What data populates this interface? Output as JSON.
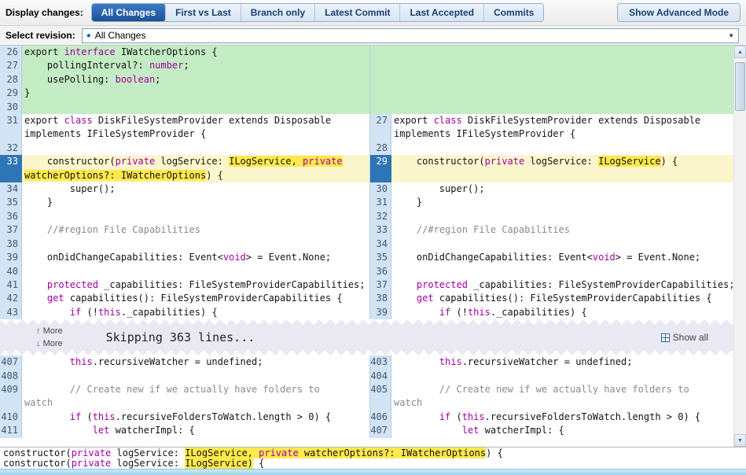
{
  "toolbar": {
    "display_changes_label": "Display changes:",
    "tabs": [
      {
        "label": "All Changes",
        "selected": true
      },
      {
        "label": "First vs Last",
        "selected": false
      },
      {
        "label": "Branch only",
        "selected": false
      },
      {
        "label": "Latest Commit",
        "selected": false
      },
      {
        "label": "Last Accepted",
        "selected": false
      },
      {
        "label": "Commits",
        "selected": false
      }
    ],
    "advanced_button": "Show Advanced Mode"
  },
  "revision": {
    "label": "Select revision:",
    "selected": "All Changes"
  },
  "icons": {
    "revision_dot": "●",
    "dropdown_caret": "▼",
    "more_up": "↑",
    "more_down": "↓",
    "scroll_up": "▲",
    "scroll_down": "▼"
  },
  "skip_band": {
    "more_up_label": "More",
    "more_down_label": "More",
    "skipping_text": "Skipping 363 lines...",
    "show_all_label": "Show all"
  },
  "colors": {
    "added_bg": "#c4ecc4",
    "changed_bg": "#fbf6cc",
    "intraline_highlight": "#ffe94d",
    "changed_line_marker": "#2e75b6",
    "selected_tab": "#1d5194"
  },
  "diff": {
    "sections": [
      {
        "rows": [
          {
            "l": {
              "num": "26",
              "bg": "add",
              "seg": [
                [
                  "export ",
                  ""
                ],
                [
                  "interface",
                  "k"
                ],
                [
                  " IWatcherOptions {",
                  ""
                ]
              ]
            },
            "r": {
              "bg": "add",
              "gut": "add",
              "seg": []
            }
          },
          {
            "l": {
              "num": "27",
              "bg": "add",
              "seg": [
                [
                  "    pollingInterval?: ",
                  ""
                ],
                [
                  "number",
                  "k"
                ],
                [
                  ";",
                  ""
                ]
              ]
            },
            "r": {
              "bg": "add",
              "gut": "add",
              "seg": []
            }
          },
          {
            "l": {
              "num": "28",
              "bg": "add",
              "seg": [
                [
                  "    usePolling: ",
                  ""
                ],
                [
                  "boolean",
                  "k"
                ],
                [
                  ";",
                  ""
                ]
              ]
            },
            "r": {
              "bg": "add",
              "gut": "add",
              "seg": []
            }
          },
          {
            "l": {
              "num": "29",
              "bg": "add",
              "seg": [
                [
                  "}",
                  ""
                ]
              ]
            },
            "r": {
              "bg": "add",
              "gut": "add",
              "seg": []
            }
          },
          {
            "l": {
              "num": "30",
              "bg": "add",
              "seg": []
            },
            "r": {
              "bg": "add",
              "gut": "add",
              "seg": []
            }
          },
          {
            "l": {
              "num": "31",
              "seg": [
                [
                  "export ",
                  ""
                ],
                [
                  "class",
                  "k"
                ],
                [
                  " DiskFileSystemProvider extends Disposable",
                  ""
                ]
              ]
            },
            "r": {
              "num": "27",
              "seg": [
                [
                  "export ",
                  ""
                ],
                [
                  "class",
                  "k"
                ],
                [
                  " DiskFileSystemProvider extends Disposable",
                  ""
                ]
              ]
            }
          },
          {
            "l": {
              "seg": [
                [
                  "implements IFileSystemProvider {",
                  ""
                ]
              ]
            },
            "r": {
              "seg": [
                [
                  "implements IFileSystemProvider {",
                  ""
                ]
              ]
            }
          },
          {
            "l": {
              "num": "32",
              "seg": []
            },
            "r": {
              "num": "28",
              "seg": []
            }
          },
          {
            "l": {
              "num": "33",
              "bg": "chg",
              "mark": true,
              "seg": [
                [
                  "    constructor(",
                  ""
                ],
                [
                  "private",
                  "k"
                ],
                [
                  " logService: ",
                  ""
                ],
                [
                  "ILogService, ",
                  "h"
                ],
                [
                  "private",
                  "k h"
                ]
              ]
            },
            "r": {
              "num": "29",
              "bg": "chg",
              "mark": true,
              "seg": [
                [
                  "    constructor(",
                  ""
                ],
                [
                  "private",
                  "k"
                ],
                [
                  " logService: ",
                  ""
                ],
                [
                  "ILogService",
                  "h"
                ],
                [
                  ") {",
                  ""
                ]
              ]
            }
          },
          {
            "l": {
              "bg": "chg",
              "mark": true,
              "seg": [
                [
                  "watcherOptions?: IWatcherOptions",
                  "h"
                ],
                [
                  ") {",
                  ""
                ]
              ]
            },
            "r": {
              "bg": "chg",
              "mark": true,
              "seg": []
            }
          },
          {
            "l": {
              "num": "34",
              "seg": [
                [
                  "        super();",
                  ""
                ]
              ]
            },
            "r": {
              "num": "30",
              "seg": [
                [
                  "        super();",
                  ""
                ]
              ]
            }
          },
          {
            "l": {
              "num": "35",
              "seg": [
                [
                  "    }",
                  ""
                ]
              ]
            },
            "r": {
              "num": "31",
              "seg": [
                [
                  "    }",
                  ""
                ]
              ]
            }
          },
          {
            "l": {
              "num": "36",
              "seg": []
            },
            "r": {
              "num": "32",
              "seg": []
            }
          },
          {
            "l": {
              "num": "37",
              "seg": [
                [
                  "    //#region File Capabilities",
                  "c"
                ]
              ]
            },
            "r": {
              "num": "33",
              "seg": [
                [
                  "    //#region File Capabilities",
                  "c"
                ]
              ]
            }
          },
          {
            "l": {
              "num": "38",
              "seg": []
            },
            "r": {
              "num": "34",
              "seg": []
            }
          },
          {
            "l": {
              "num": "39",
              "seg": [
                [
                  "    onDidChangeCapabilities: Event<",
                  ""
                ],
                [
                  "void",
                  "k"
                ],
                [
                  "> = Event.None;",
                  ""
                ]
              ]
            },
            "r": {
              "num": "35",
              "seg": [
                [
                  "    onDidChangeCapabilities: Event<",
                  ""
                ],
                [
                  "void",
                  "k"
                ],
                [
                  "> = Event.None;",
                  ""
                ]
              ]
            }
          },
          {
            "l": {
              "num": "40",
              "seg": []
            },
            "r": {
              "num": "36",
              "seg": []
            }
          },
          {
            "l": {
              "num": "41",
              "seg": [
                [
                  "    ",
                  ""
                ],
                [
                  "protected",
                  "k"
                ],
                [
                  " _capabilities: FileSystemProviderCapabilities;",
                  ""
                ]
              ]
            },
            "r": {
              "num": "37",
              "seg": [
                [
                  "    ",
                  ""
                ],
                [
                  "protected",
                  "k"
                ],
                [
                  " _capabilities: FileSystemProviderCapabilities;",
                  ""
                ]
              ]
            }
          },
          {
            "l": {
              "num": "42",
              "seg": [
                [
                  "    ",
                  ""
                ],
                [
                  "get",
                  "k"
                ],
                [
                  " capabilities(): FileSystemProviderCapabilities {",
                  ""
                ]
              ]
            },
            "r": {
              "num": "38",
              "seg": [
                [
                  "    ",
                  ""
                ],
                [
                  "get",
                  "k"
                ],
                [
                  " capabilities(): FileSystemProviderCapabilities {",
                  ""
                ]
              ]
            }
          },
          {
            "l": {
              "num": "43",
              "seg": [
                [
                  "        ",
                  ""
                ],
                [
                  "if",
                  "k"
                ],
                [
                  " (!",
                  ""
                ],
                [
                  "this",
                  "k"
                ],
                [
                  "._capabilities) {",
                  ""
                ]
              ]
            },
            "r": {
              "num": "39",
              "seg": [
                [
                  "        ",
                  ""
                ],
                [
                  "if",
                  "k"
                ],
                [
                  " (!",
                  ""
                ],
                [
                  "this",
                  "k"
                ],
                [
                  "._capabilities) {",
                  ""
                ]
              ]
            }
          }
        ]
      },
      {
        "rows": [
          {
            "l": {
              "num": "407",
              "seg": [
                [
                  "        ",
                  ""
                ],
                [
                  "this",
                  "k"
                ],
                [
                  ".recursiveWatcher = undefined;",
                  ""
                ]
              ]
            },
            "r": {
              "num": "403",
              "seg": [
                [
                  "        ",
                  ""
                ],
                [
                  "this",
                  "k"
                ],
                [
                  ".recursiveWatcher = undefined;",
                  ""
                ]
              ]
            }
          },
          {
            "l": {
              "num": "408",
              "seg": []
            },
            "r": {
              "num": "404",
              "seg": []
            }
          },
          {
            "l": {
              "num": "409",
              "seg": [
                [
                  "        // Create new if we actually have folders to",
                  "c"
                ]
              ]
            },
            "r": {
              "num": "405",
              "seg": [
                [
                  "        // Create new if we actually have folders to",
                  "c"
                ]
              ]
            }
          },
          {
            "l": {
              "seg": [
                [
                  "watch",
                  "c"
                ]
              ]
            },
            "r": {
              "seg": [
                [
                  "watch",
                  "c"
                ]
              ]
            }
          },
          {
            "l": {
              "num": "410",
              "seg": [
                [
                  "        ",
                  ""
                ],
                [
                  "if",
                  "k"
                ],
                [
                  " (",
                  ""
                ],
                [
                  "this",
                  "k"
                ],
                [
                  ".recursiveFoldersToWatch.length > 0) {",
                  ""
                ]
              ]
            },
            "r": {
              "num": "406",
              "seg": [
                [
                  "        ",
                  ""
                ],
                [
                  "if",
                  "k"
                ],
                [
                  " (",
                  ""
                ],
                [
                  "this",
                  "k"
                ],
                [
                  ".recursiveFoldersToWatch.length > 0) {",
                  ""
                ]
              ]
            }
          },
          {
            "l": {
              "num": "411",
              "seg": [
                [
                  "            ",
                  ""
                ],
                [
                  "let",
                  "k"
                ],
                [
                  " watcherImpl: {",
                  ""
                ]
              ]
            },
            "r": {
              "num": "407",
              "seg": [
                [
                  "            ",
                  ""
                ],
                [
                  "let",
                  "k"
                ],
                [
                  " watcherImpl: {",
                  ""
                ]
              ]
            }
          }
        ]
      }
    ]
  },
  "footer": {
    "lines": [
      [
        [
          "constructor(",
          ""
        ],
        [
          "private",
          "k"
        ],
        [
          " logService: ",
          ""
        ],
        [
          "ILogService, ",
          "h"
        ],
        [
          "private",
          "k h"
        ],
        [
          " watcherOptions?: IWatcherOptions",
          "h"
        ],
        [
          ") {",
          ""
        ]
      ],
      [
        [
          "constructor(",
          ""
        ],
        [
          "private",
          "k"
        ],
        [
          " logService: ",
          ""
        ],
        [
          "ILogService)",
          "h"
        ],
        [
          " {",
          ""
        ]
      ]
    ]
  }
}
